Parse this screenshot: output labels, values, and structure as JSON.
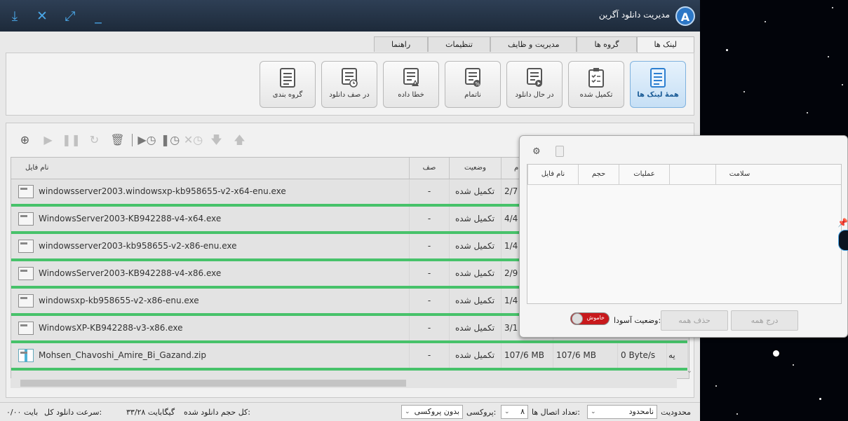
{
  "window": {
    "title": "مدیریت دانلود آگرین",
    "logo_letter": "A",
    "controls": [
      "download-icon",
      "close-icon",
      "fullscreen-icon",
      "minimize-icon"
    ]
  },
  "tabs": [
    {
      "label": "لینک ها",
      "active": true
    },
    {
      "label": "گروه ها",
      "active": false
    },
    {
      "label": "مدیریت و ظایف",
      "active": false
    },
    {
      "label": "تنظیمات",
      "active": false
    },
    {
      "label": "راهنما",
      "active": false
    }
  ],
  "ribbon": [
    {
      "label": "همهٔ لینک ها",
      "icon": "list-icon",
      "active": true
    },
    {
      "label": "تکمیل شده",
      "icon": "clipboard-check-icon",
      "active": false
    },
    {
      "label": "در حال دانلود",
      "icon": "list-play-icon",
      "active": false
    },
    {
      "label": "ناتمام",
      "icon": "list-percent-icon",
      "active": false
    },
    {
      "label": "خطا داده",
      "icon": "list-warning-icon",
      "active": false
    },
    {
      "label": "در صف دانلود",
      "icon": "list-clock-icon",
      "active": false
    },
    {
      "label": "گروه بندی",
      "icon": "list-group-icon",
      "active": false
    }
  ],
  "toolbar": [
    "add-icon",
    "play-icon",
    "pause-icon",
    "refresh-icon",
    "delete-icon",
    "schedule-start-icon",
    "schedule-stop-icon",
    "schedule-cancel-icon",
    "move-down-icon",
    "move-up-icon"
  ],
  "grid": {
    "headers": {
      "filename": "نام فایل",
      "queue": "صف",
      "status": "وضعیت",
      "date": "م"
    },
    "rows": [
      {
        "name": "windowsserver2003.windowsxp-kb958655-v2-x64-enu.exe",
        "queue": "-",
        "status": "تکمیل شده",
        "date": "2/7",
        "type": "exe",
        "progress": 100
      },
      {
        "name": "WindowsServer2003-KB942288-v4-x64.exe",
        "queue": "-",
        "status": "تکمیل شده",
        "date": "4/4",
        "type": "exe",
        "progress": 100
      },
      {
        "name": "windowsserver2003-kb958655-v2-x86-enu.exe",
        "queue": "-",
        "status": "تکمیل شده",
        "date": "1/4",
        "type": "exe",
        "progress": 100
      },
      {
        "name": "WindowsServer2003-KB942288-v4-x86.exe",
        "queue": "-",
        "status": "تکمیل شده",
        "date": "2/9",
        "type": "exe",
        "progress": 100
      },
      {
        "name": "windowsxp-kb958655-v2-x86-enu.exe",
        "queue": "-",
        "status": "تکمیل شده",
        "date": "1/4",
        "type": "exe",
        "progress": 100
      },
      {
        "name": "WindowsXP-KB942288-v3-x86.exe",
        "queue": "-",
        "status": "تکمیل شده",
        "date": "3/1",
        "type": "exe",
        "progress": 100
      },
      {
        "name": "Mohsen_Chavoshi_Amire_Bi_Gazand.zip",
        "queue": "-",
        "status": "تکمیل شده",
        "date": "107/6 MB",
        "size": "107/6 MB",
        "speed": "0 Byte/s",
        "extra": "یه",
        "type": "zip",
        "progress": 100
      }
    ]
  },
  "queue_window": {
    "headers": {
      "health": "سلامت",
      "ops": "عملیات",
      "size": "حجم",
      "filename": "نام فایل"
    },
    "add_all": "درج همه",
    "remove_all": "حذف همه",
    "relax_label": "وضعیت آسودا:",
    "toggle_label": "خاموش"
  },
  "status": {
    "limit_label": "محدودیت",
    "limit_value": "نامحدود",
    "connections_label": "تعداد اتصال ها:",
    "connections_value": "۸",
    "proxy_label": "پروکسی:",
    "proxy_value": "بدون پروکسی",
    "total_downloaded_label": "کل حجم دانلود شده:",
    "total_downloaded_value": "۳۳/۲۸ گیگابایت",
    "speed_label": "سرعت دانلود کل:",
    "speed_value": "۰/۰۰ بایت"
  },
  "colors": {
    "accent": "#4aa6e6",
    "titlebar": "#243347",
    "progress": "#47c26a",
    "toggle": "#c8191c"
  }
}
